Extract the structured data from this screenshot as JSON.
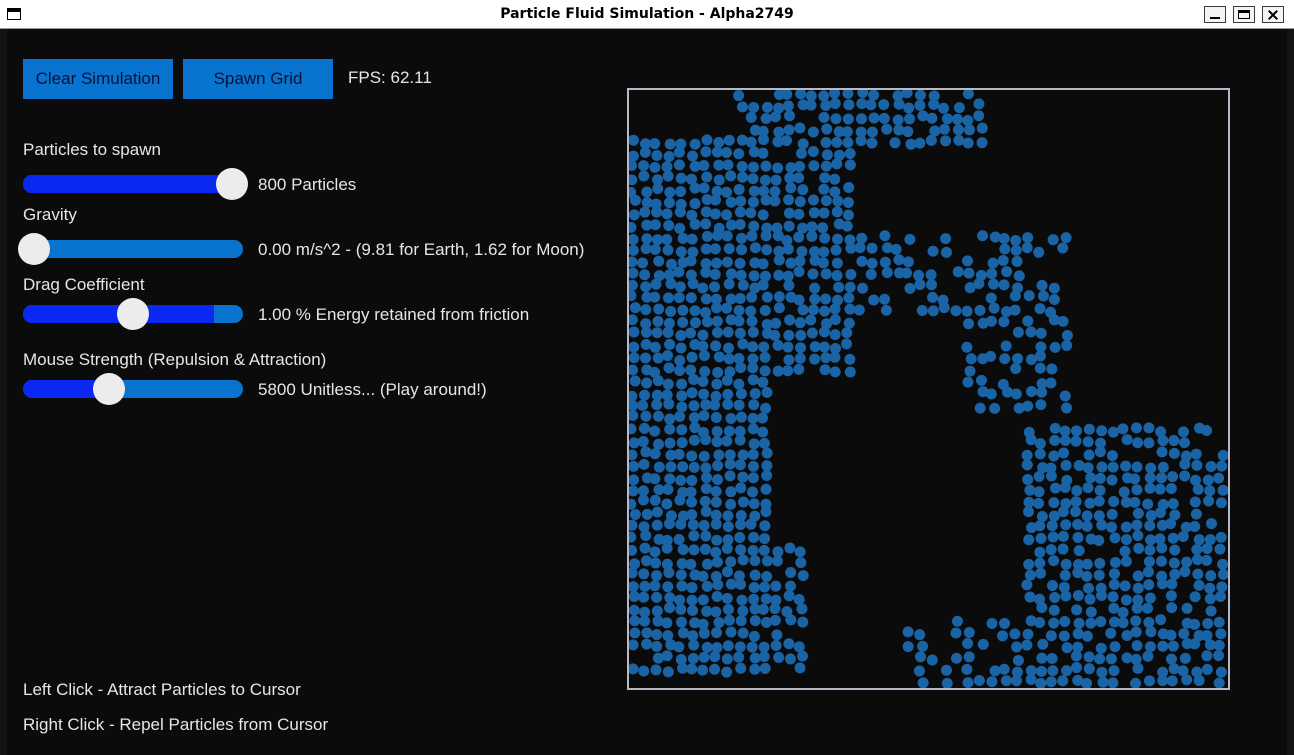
{
  "window": {
    "title": "Particle Fluid Simulation - Alpha2749"
  },
  "toolbar": {
    "clear_label": "Clear Simulation",
    "spawn_label": "Spawn Grid",
    "fps_text": "FPS: 62.11"
  },
  "controls": {
    "particles": {
      "label": "Particles to spawn",
      "value_text": "800 Particles",
      "fraction": 0.95
    },
    "gravity": {
      "label": "Gravity",
      "value_text": "0.00 m/s^2 - (9.81 for Earth, 1.62 for Moon)",
      "fraction": 0.05
    },
    "drag": {
      "label": "Drag Coefficient",
      "value_text": "1.00 % Energy retained from friction",
      "fraction": 0.5,
      "filled_fraction": 0.87
    },
    "mouse": {
      "label": "Mouse Strength (Repulsion & Attraction)",
      "value_text": "5800 Unitless... (Play around!)",
      "fraction": 0.39
    }
  },
  "help": {
    "left_click": "Left Click - Attract Particles to Cursor",
    "right_click": "Right Click - Repel Particles from Cursor"
  },
  "colors": {
    "button": "#0874d0",
    "slider_fill": "#0a28f2",
    "particle": "#1a64a6",
    "background": "#0b0b0b"
  }
}
